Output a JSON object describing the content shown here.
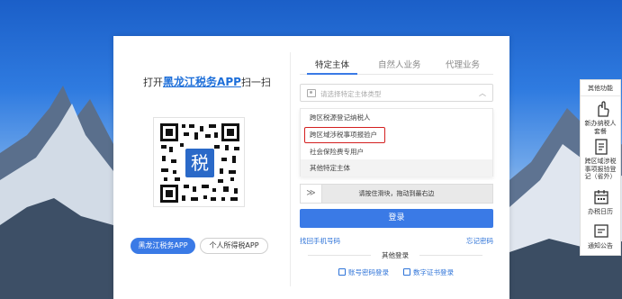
{
  "qr_panel": {
    "title_prefix": "打开",
    "app_name": "黑龙江税务APP",
    "title_suffix": "扫一扫",
    "qr_center_char": "税",
    "buttons": [
      {
        "label": "黑龙江税务APP",
        "active": true
      },
      {
        "label": "个人所得税APP",
        "active": false
      }
    ]
  },
  "tabs": [
    {
      "label": "特定主体",
      "active": true
    },
    {
      "label": "自然人业务",
      "active": false
    },
    {
      "label": "代理业务",
      "active": false
    }
  ],
  "entity_select": {
    "placeholder": "请选择特定主体类型",
    "options": [
      {
        "label": "跨区税源登记纳税人"
      },
      {
        "label": "跨区域涉税事项报验户",
        "boxed": true
      },
      {
        "label": "社会保险费专用户"
      },
      {
        "label": "其他特定主体",
        "highlighted": true
      }
    ]
  },
  "slider": {
    "handle_glyph": "≫",
    "text": "请按住滑块，拖动到最右边"
  },
  "login_button": "登录",
  "links": {
    "find_phone": "找回手机号码",
    "forgot_password": "忘记密码"
  },
  "other_login": {
    "title": "其他登录",
    "options": [
      {
        "label": "账号密码登录"
      },
      {
        "label": "数字证书登录"
      }
    ]
  },
  "side_panel": {
    "title": "其他功能",
    "items": [
      {
        "icon": "hand-pointer-icon",
        "lines": [
          "新办纳税人",
          "套餐"
        ]
      },
      {
        "icon": "document-icon",
        "lines": [
          "跨区域涉税",
          "事项报验登",
          "记（省外）"
        ]
      },
      {
        "icon": "calendar-icon",
        "lines": [
          "办税日历"
        ]
      },
      {
        "icon": "notice-icon",
        "lines": [
          "通知公告"
        ]
      }
    ]
  },
  "colors": {
    "brand_blue": "#3a7ae6",
    "link_blue": "#2e73d8",
    "highlight_red": "#d42020",
    "sky_top": "#1b5fc8"
  }
}
